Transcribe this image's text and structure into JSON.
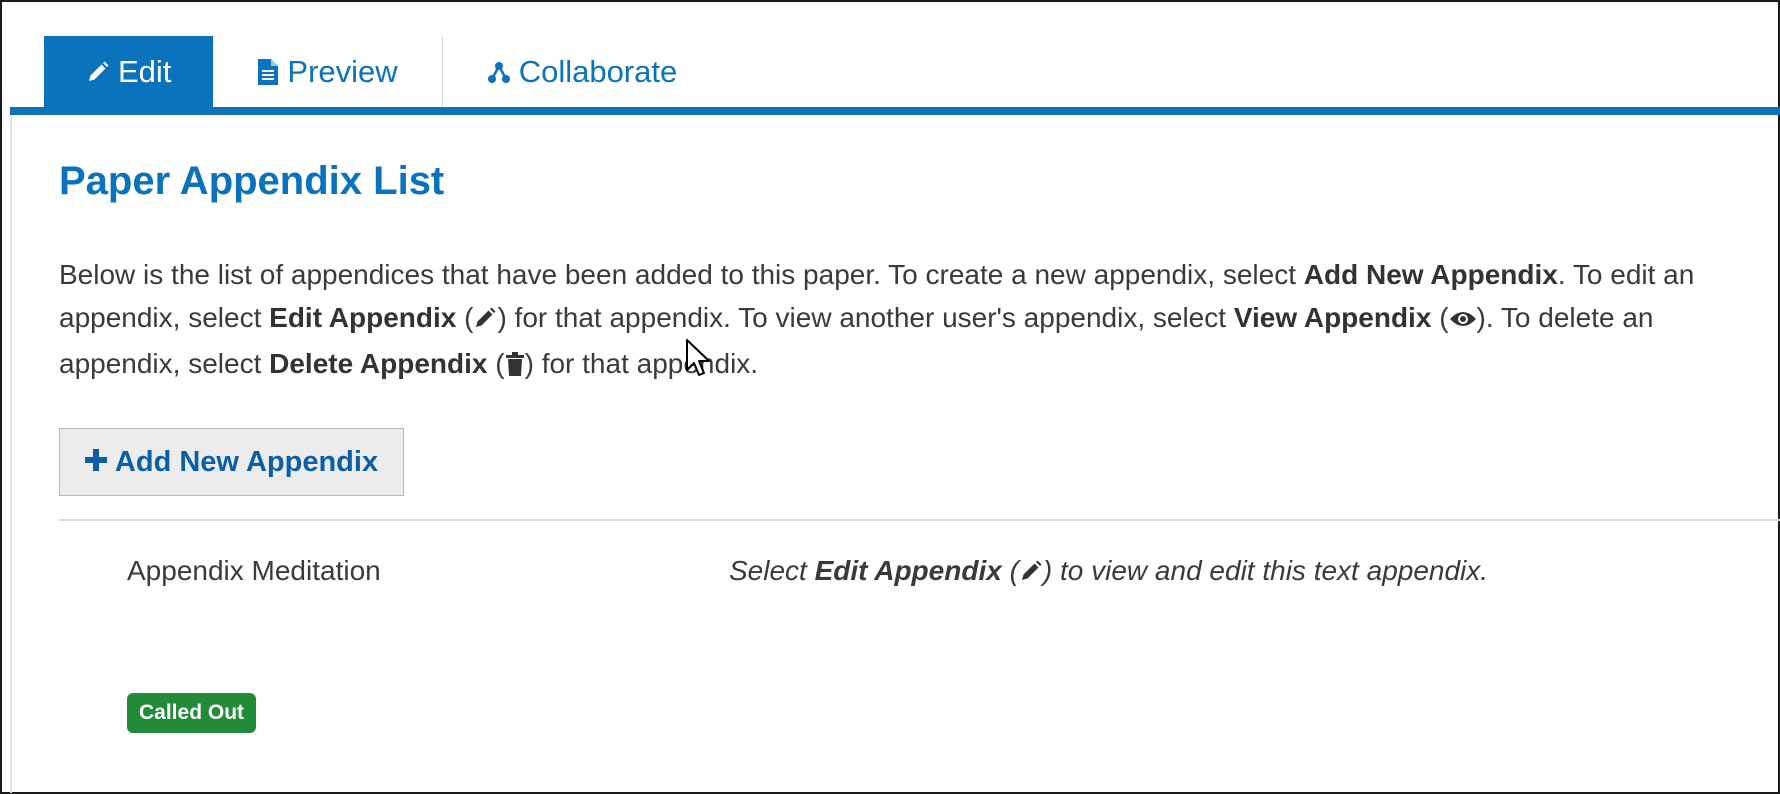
{
  "tabs": [
    {
      "label": "Edit",
      "icon": "pencil-icon",
      "active": true
    },
    {
      "label": "Preview",
      "icon": "document-icon",
      "active": false
    },
    {
      "label": "Collaborate",
      "icon": "share-nodes-icon",
      "active": false
    }
  ],
  "page": {
    "title": "Paper Appendix List"
  },
  "intro": {
    "t1": "Below is the list of appendices that have been added to this paper. To create a new appendix, select ",
    "b1": "Add New Appendix",
    "t2": ". To edit an appendix, select ",
    "b2": "Edit Appendix",
    "t3": " (",
    "t4": ") for that appendix. To view another user's appendix, select ",
    "b3": "View Appendix",
    "t5": " (",
    "t6": "). To delete an appendix, select ",
    "b4": "Delete Appendix",
    "t7": " (",
    "t8": ") for that appendix."
  },
  "add_button": {
    "label": "Add New Appendix",
    "icon": "plus-icon"
  },
  "appendix": {
    "name": "Appendix Meditation",
    "note_pre": "Select ",
    "note_bold": "Edit Appendix",
    "note_mid": " (",
    "note_post": ") to view and edit this text appendix.",
    "badge": "Called Out"
  },
  "colors": {
    "primary": "#0a73bb",
    "badge_green": "#228b3a",
    "text": "#3a3a3a"
  }
}
